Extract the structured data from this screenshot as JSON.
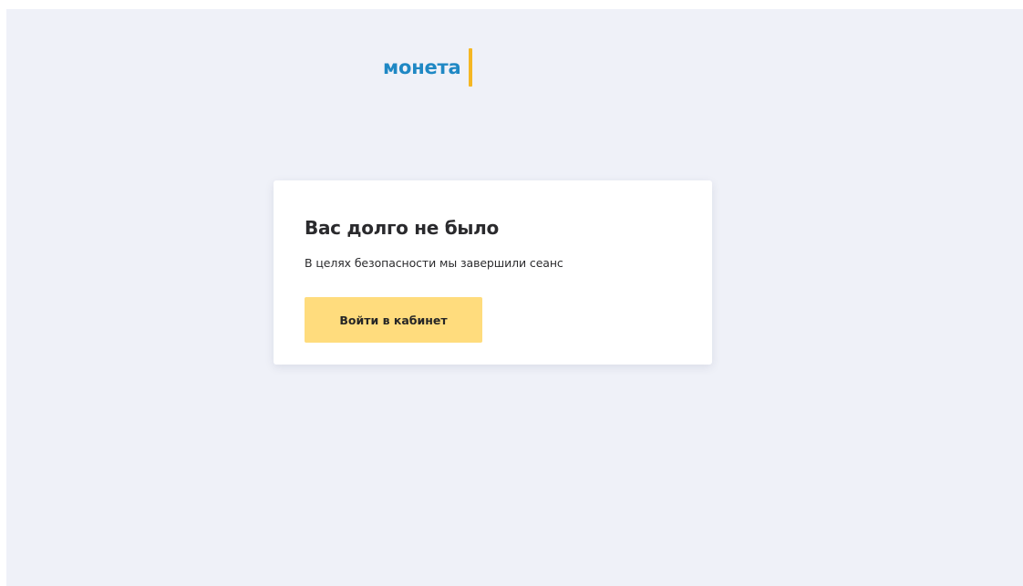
{
  "brand": {
    "logo_text": "монета"
  },
  "dialog": {
    "title": "Вас долго не было",
    "message": "В целях безопасности мы завершили сеанс",
    "button_label": "Войти в кабинет"
  },
  "colors": {
    "background": "#eff1f8",
    "logo_text": "#1f88c4",
    "logo_accent": "#f5b724",
    "button": "#ffdc7d"
  }
}
